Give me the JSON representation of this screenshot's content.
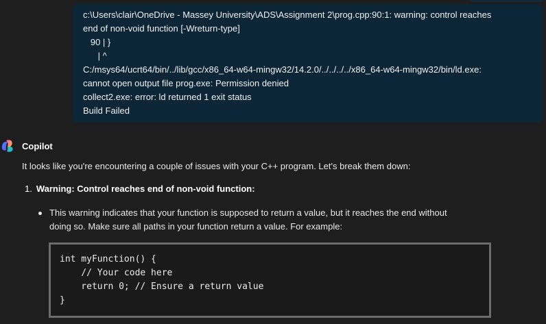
{
  "user_message": {
    "lines": [
      "c:\\Users\\clair\\OneDrive - Massey University\\ADS\\Assignment 2\\prog.cpp:90:1: warning: control reaches",
      "end of non-void function [-Wreturn-type]",
      "   90 | }",
      "      | ^",
      "C:/msys64/ucrt64/bin/../lib/gcc/x86_64-w64-mingw32/14.2.0/../../../../x86_64-w64-mingw32/bin/ld.exe:",
      "cannot open output file prog.exe: Permission denied",
      "collect2.exe: error: ld returned 1 exit status",
      "Build Failed"
    ]
  },
  "assistant": {
    "name": "Copilot",
    "logo_icon": "copilot-logo-icon",
    "intro": "It looks like you're encountering a couple of issues with your C++ program. Let's break them down:",
    "item_number": "1.",
    "item_heading": "Warning: Control reaches end of non-void function:",
    "bullet_line_1": "This warning indicates that your function is supposed to return a value, but it reaches the end without",
    "bullet_line_2": "doing so. Make sure all paths in your function return a value. For example:",
    "code_lines": [
      "int myFunction() {",
      "    // Your code here",
      "    return 0; // Ensure a return value",
      "}"
    ]
  },
  "colors": {
    "background": "#1e1e1e",
    "user_bubble": "#0c2638",
    "code_border": "#6b6b6b"
  }
}
